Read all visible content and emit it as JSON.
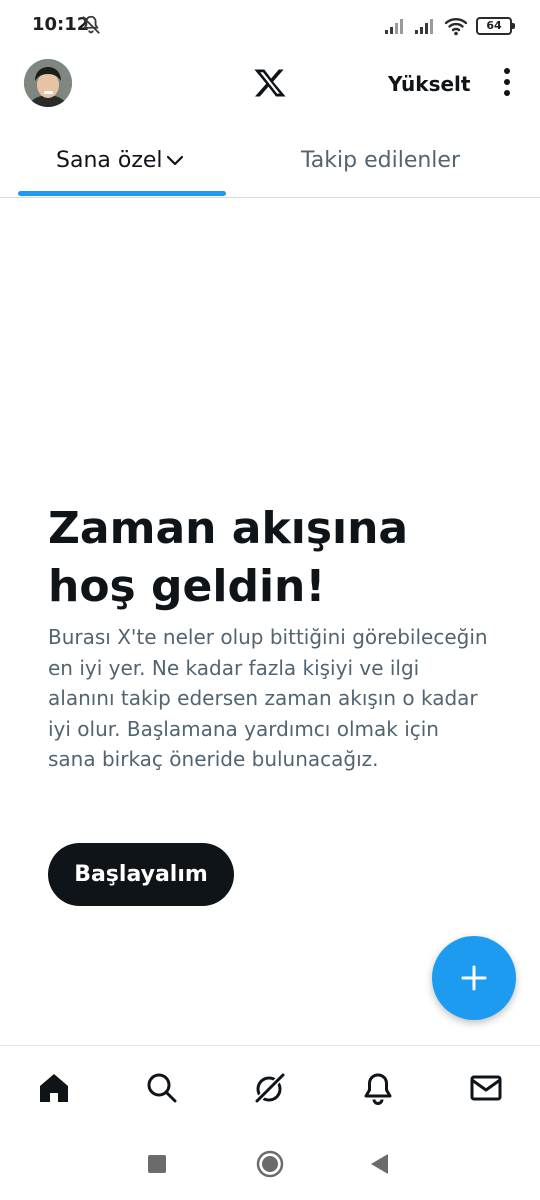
{
  "status_bar": {
    "time": "10:12",
    "battery": "64",
    "icons": [
      "notifications-off-icon",
      "signal-icon",
      "signal-icon",
      "wifi-icon",
      "battery-icon"
    ]
  },
  "header": {
    "upgrade_label": "Yükselt",
    "logo_icon": "x-logo-icon",
    "more_icon": "more-vertical-icon"
  },
  "tabs": [
    {
      "label": "Sana özel",
      "active": true,
      "has_dropdown": true
    },
    {
      "label": "Takip edilenler",
      "active": false
    }
  ],
  "welcome": {
    "title": "Zaman akışına hoş geldin!",
    "body": "Burası X'te neler olup bittiğini görebileceğin en iyi yer. Ne kadar fazla kişiyi ve ilgi alanını takip edersen zaman akışın o kadar iyi olur. Başlamana yardımcı olmak için sana birkaç öneride bulunacağız.",
    "button_label": "Başlayalım"
  },
  "fab": {
    "icon": "plus-icon"
  },
  "bottom_nav": [
    "home-icon",
    "search-icon",
    "grok-icon",
    "notifications-icon",
    "messages-icon"
  ],
  "system_nav": [
    "recents-icon",
    "home-circle-icon",
    "back-icon"
  ],
  "colors": {
    "accent": "#1d9bf0",
    "text_primary": "#0f1419",
    "text_secondary": "#536471",
    "button_dark": "#0f1419"
  }
}
